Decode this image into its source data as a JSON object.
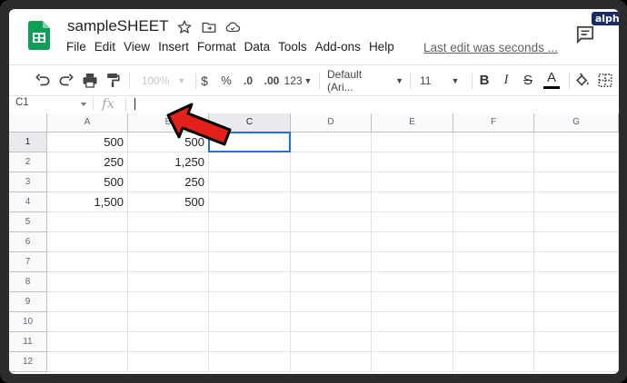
{
  "watermark": "alphr",
  "doc": {
    "title": "sampleSHEET"
  },
  "menu": [
    "File",
    "Edit",
    "View",
    "Insert",
    "Format",
    "Data",
    "Tools",
    "Add-ons",
    "Help"
  ],
  "last_edit": "Last edit was seconds ...",
  "toolbar": {
    "zoom": "100%",
    "currency": "$",
    "percent": "%",
    "dec_decrease": ".0",
    "dec_increase": ".00",
    "more_formats": "123",
    "font": "Default (Ari...",
    "font_size": "11",
    "bold": "B",
    "italic": "I",
    "strike": "S",
    "text_color": "A"
  },
  "formula_bar": {
    "name_box": "C1",
    "fx": "fx",
    "value": ""
  },
  "columns": [
    "A",
    "B",
    "C",
    "D",
    "E",
    "F",
    "G"
  ],
  "rows": [
    "1",
    "2",
    "3",
    "4",
    "5",
    "6",
    "7",
    "8",
    "9",
    "10",
    "11",
    "12"
  ],
  "cells": [
    [
      "500",
      "500"
    ],
    [
      "250",
      "1,250"
    ],
    [
      "500",
      "250"
    ],
    [
      "1,500",
      "500"
    ]
  ],
  "selected_cell": "C1",
  "colors": {
    "accent": "#1a73e8",
    "logo_green": "#0f9d58",
    "arrow": "#e3201b"
  },
  "icons": [
    "sheets-logo-icon",
    "star-icon",
    "move-folder-icon",
    "cloud-saved-icon",
    "comment-icon",
    "undo-icon",
    "redo-icon",
    "print-icon",
    "paint-format-icon",
    "fill-color-icon",
    "borders-icon",
    "pointer-arrow-icon"
  ]
}
